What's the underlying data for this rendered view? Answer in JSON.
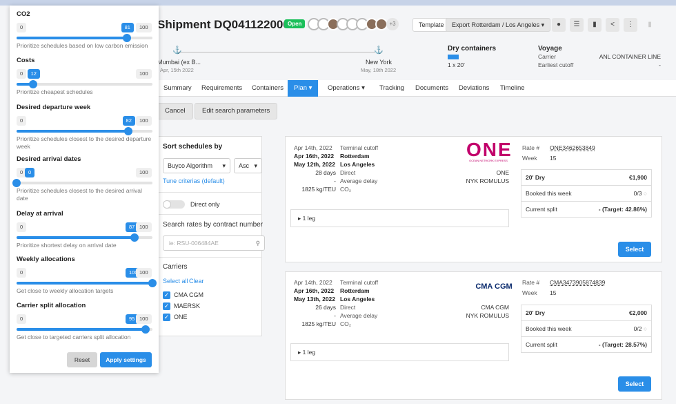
{
  "header": {
    "title": "Shipment DQ0411220006",
    "status": "Open",
    "more_avatars": "+3",
    "template_label": "Template",
    "export_label": "Export Rotterdam / Los Angeles"
  },
  "route": {
    "origin": "Mumbai (ex B...",
    "origin_date": "Apr, 15th 2022",
    "dest": "New York",
    "dest_date": "May, 18th 2022"
  },
  "containers": {
    "title": "Dry containers",
    "qty": "1 x 20'"
  },
  "voyage": {
    "title": "Voyage",
    "carrier_label": "Carrier",
    "carrier_value": "ANL CONTAINER LINE",
    "cutoff_label": "Earliest cutoff",
    "cutoff_value": "-"
  },
  "tabs": [
    "Summary",
    "Requirements",
    "Containers",
    "Plan",
    "Operations",
    "Tracking",
    "Documents",
    "Deviations",
    "Timeline"
  ],
  "actions": {
    "cancel": "Cancel",
    "edit": "Edit search parameters"
  },
  "sort": {
    "title": "Sort schedules by",
    "algorithm": "Buyco Algorithm",
    "order": "Asc",
    "tune": "Tune criterias (default)",
    "direct_only": "Direct only",
    "search_title": "Search rates by contract number",
    "search_placeholder": "ie: RSU-006484AE",
    "carriers_title": "Carriers",
    "select_all": "Select all",
    "clear": "Clear",
    "carriers": [
      "CMA CGM",
      "MAERSK",
      "ONE"
    ]
  },
  "cards": [
    {
      "date1": "Apr 14th, 2022",
      "lbl1": "Terminal cutoff",
      "date2": "Apr 16th, 2022",
      "lbl2": "Rotterdam",
      "date3": "May 12th, 2022",
      "lbl3": "Los Angeles",
      "days": "28 days",
      "lbl4": "Direct",
      "delay": "-",
      "lbl5": "Average delay",
      "co2": "1825 kg/TEU",
      "lbl6": "CO₂",
      "carrier": "ONE",
      "vessel": "NYK ROMULUS",
      "rate_label": "Rate #",
      "rate": "ONE3462653849",
      "week_label": "Week",
      "week": "15",
      "ctype": "20' Dry",
      "price": "€1,900",
      "booked_label": "Booked this week",
      "booked": "0/3",
      "split_label": "Current split",
      "split": "- (Target: 42.86%)",
      "legs": "1 leg",
      "select": "Select",
      "logo": "ONE",
      "logo_sub": "OCEAN NETWORK EXPRESS"
    },
    {
      "date1": "Apr 14th, 2022",
      "lbl1": "Terminal cutoff",
      "date2": "Apr 16th, 2022",
      "lbl2": "Rotterdam",
      "date3": "May 13th, 2022",
      "lbl3": "Los Angeles",
      "days": "26 days",
      "lbl4": "Direct",
      "delay": "-",
      "lbl5": "Average delay",
      "co2": "1825 kg/TEU",
      "lbl6": "CO₂",
      "carrier": "CMA CGM",
      "vessel": "NYK ROMULUS",
      "rate_label": "Rate #",
      "rate": "CMA3473905874839",
      "week_label": "Week",
      "week": "15",
      "ctype": "20' Dry",
      "price": "€2,000",
      "booked_label": "Booked this week",
      "booked": "0/2",
      "split_label": "Current split",
      "split": "- (Target: 28.57%)",
      "legs": "1 leg",
      "select": "Select",
      "logo": "CMA CGM"
    }
  ],
  "settings": {
    "sliders": [
      {
        "title": "CO2",
        "min": "0",
        "val": "81",
        "max": "100",
        "pct": 81,
        "desc": "Prioritize schedules based on low carbon emission"
      },
      {
        "title": "Costs",
        "min": "0",
        "val": "12",
        "max": "100",
        "pct": 12,
        "desc": "Prioritize cheapest schedules"
      },
      {
        "title": "Desired departure week",
        "min": "0",
        "val": "82",
        "max": "100",
        "pct": 82,
        "desc": "Prioritize schedules closest to the desired departure week"
      },
      {
        "title": "Desired arrival dates",
        "min": "0",
        "val": "0",
        "max": "100",
        "pct": 0,
        "desc": "Prioritize schedules closest to the desired arrival date"
      },
      {
        "title": "Delay at arrival",
        "min": "0",
        "val": "87",
        "max": "100",
        "pct": 87,
        "desc": "Prioritize shortest delay on arrival date"
      },
      {
        "title": "Weekly allocations",
        "min": "0",
        "val": "100",
        "max": "100",
        "pct": 100,
        "desc": "Get close to weekly allocation targets"
      },
      {
        "title": "Carrier split allocation",
        "min": "0",
        "val": "95",
        "max": "100",
        "pct": 95,
        "desc": "Get close to targeted carriers split allocation"
      }
    ],
    "reset": "Reset",
    "apply": "Apply settings"
  },
  "colors": {
    "accent": "#2a8ee8",
    "open": "#1bbf5a",
    "one": "#c2006b"
  }
}
